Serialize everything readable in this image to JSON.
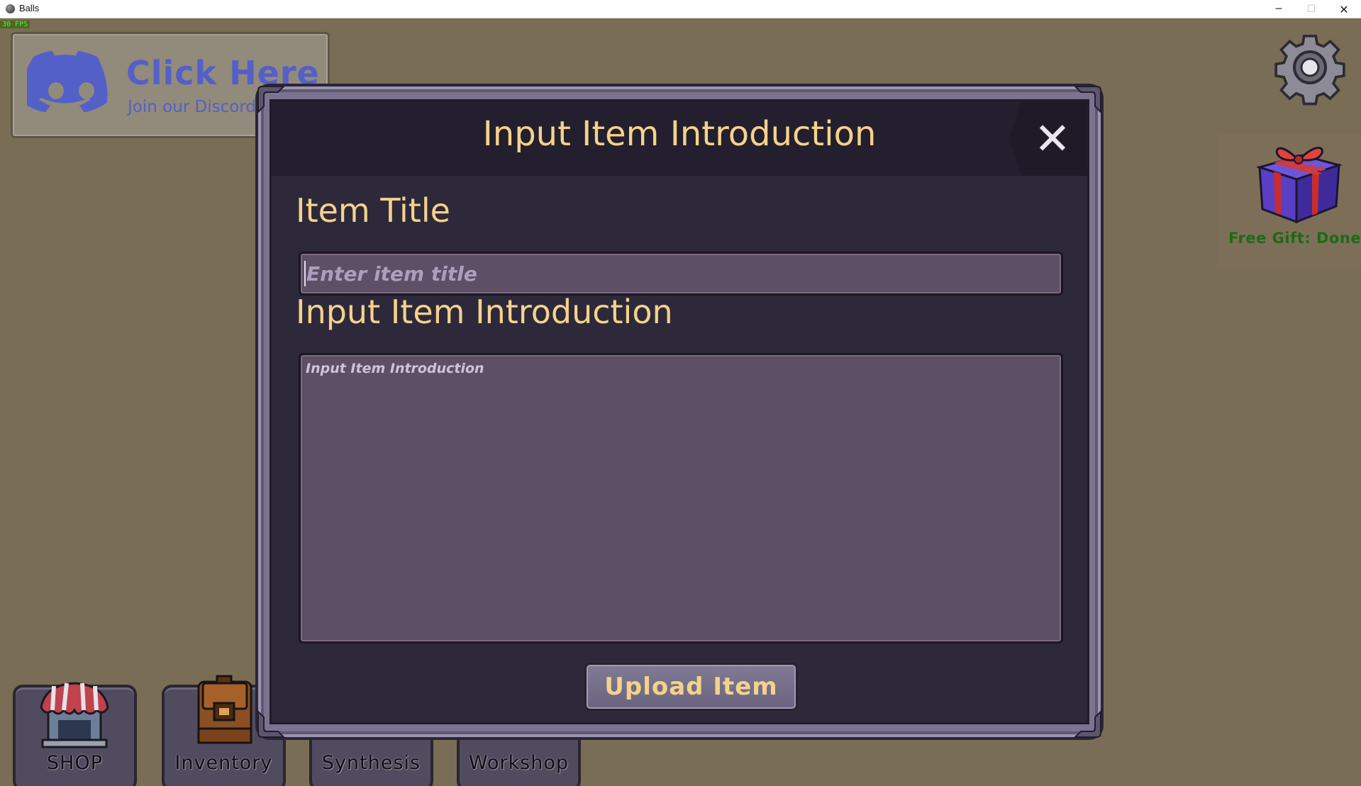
{
  "window": {
    "title": "Balls",
    "minimize_glyph": "─",
    "maximize_glyph": "☐",
    "close_glyph": "✕"
  },
  "hud": {
    "fps": "30 FPS"
  },
  "discord": {
    "headline": "Click Here",
    "subline": "Join our Discord",
    "icon": "discord-logo-icon",
    "color": "#5360c8"
  },
  "settings": {
    "icon": "gear-icon"
  },
  "gift": {
    "icon": "gift-box-icon",
    "label": "Free Gift: Done",
    "color": "#1d6a16"
  },
  "nav": {
    "items": [
      {
        "label": "SHOP",
        "icon": "shop-icon"
      },
      {
        "label": "Inventory",
        "icon": "backpack-icon"
      },
      {
        "label": "Synthesis",
        "icon": "synthesis-icon"
      },
      {
        "label": "Workshop",
        "icon": "workshop-icon"
      }
    ]
  },
  "modal": {
    "title": "Input Item Introduction",
    "close_glyph": "✕",
    "item_title_label": "Item Title",
    "item_title_placeholder": "Enter item title",
    "item_title_value": "",
    "intro_label": "Input Item Introduction",
    "intro_placeholder": "Input Item Introduction",
    "intro_value": "",
    "upload_label": "Upload Item",
    "accent": "#f4d28c"
  }
}
